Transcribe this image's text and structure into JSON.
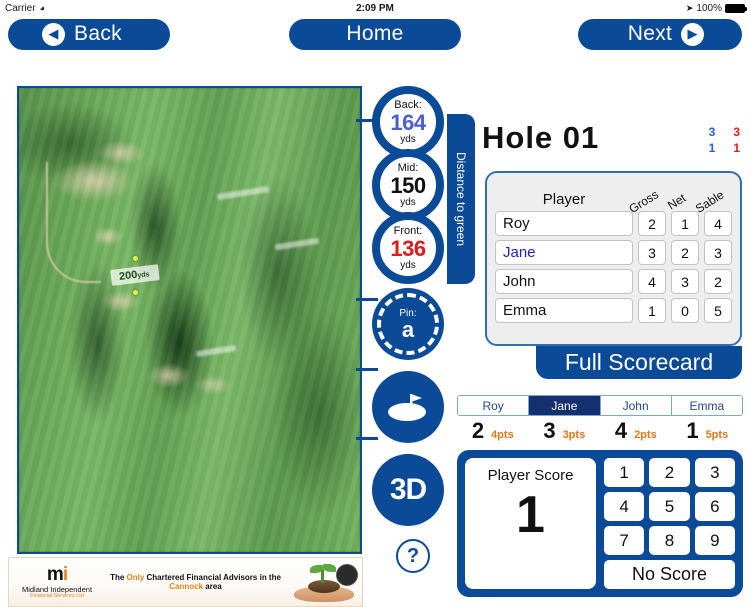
{
  "status_bar": {
    "carrier": "Carrier",
    "wifi_icon": "wifi-icon",
    "time": "2:09 PM",
    "location_icon": "location-arrow-icon",
    "battery_percent": "100%",
    "battery_icon": "battery-full-icon"
  },
  "nav": {
    "back_label": "Back",
    "back_icon": "chevron-left-circle-icon",
    "home_label": "Home",
    "next_label": "Next",
    "next_icon": "chevron-right-circle-icon"
  },
  "course": {
    "yardage_marker": "200",
    "yardage_unit": "yds"
  },
  "distances": {
    "tab_label": "Distance to green",
    "back": {
      "label": "Back:",
      "value": "164",
      "unit": "yds",
      "color": "#4a5fd0"
    },
    "mid": {
      "label": "Mid:",
      "value": "150",
      "unit": "yds",
      "color": "#111111"
    },
    "front": {
      "label": "Front:",
      "value": "136",
      "unit": "yds",
      "color": "#e01b1b"
    },
    "pin": {
      "label": "Pin:",
      "value": "a"
    }
  },
  "tools": {
    "green_view_icon": "green-flag-icon",
    "three_d_label": "3D",
    "help_label": "?"
  },
  "hole": {
    "title": "Hole 01",
    "par_blue_top": "3",
    "par_blue_bottom": "1",
    "par_red_top": "3",
    "par_red_bottom": "1"
  },
  "scorecard": {
    "headers": {
      "player": "Player",
      "gross": "Gross",
      "net": "Net",
      "stable": "Sable"
    },
    "rows": [
      {
        "name": "Roy",
        "gross": "2",
        "net": "1",
        "stable": "4",
        "active": false
      },
      {
        "name": "Jane",
        "gross": "3",
        "net": "2",
        "stable": "3",
        "active": true
      },
      {
        "name": "John",
        "gross": "4",
        "net": "3",
        "stable": "2",
        "active": false
      },
      {
        "name": "Emma",
        "gross": "1",
        "net": "0",
        "stable": "5",
        "active": false
      }
    ],
    "full_scorecard_label": "Full Scorecard"
  },
  "player_tabs": [
    {
      "label": "Roy",
      "selected": false
    },
    {
      "label": "Jane",
      "selected": true
    },
    {
      "label": "John",
      "selected": false
    },
    {
      "label": "Emma",
      "selected": false
    }
  ],
  "points_row": [
    {
      "score": "2",
      "points": "4pts"
    },
    {
      "score": "3",
      "points": "3pts"
    },
    {
      "score": "4",
      "points": "2pts"
    },
    {
      "score": "1",
      "points": "5pts"
    }
  ],
  "keypad": {
    "player_score_label": "Player Score",
    "player_score_value": "1",
    "keys": [
      "1",
      "2",
      "3",
      "4",
      "5",
      "6",
      "7",
      "8",
      "9"
    ],
    "no_score_label": "No Score"
  },
  "ad": {
    "logo_mark": "mi",
    "company": "Midland Independent",
    "company_sub": "Financial Services Ltd",
    "text_pre": "The ",
    "text_hi1": "Only",
    "text_mid": " Chartered Financial Advisors in the ",
    "text_hi2": "Cannock",
    "text_post": " area"
  },
  "colors": {
    "brand_blue": "#0a4a96",
    "tab_selected": "#14306e",
    "accent_orange": "#e07818",
    "red": "#e01b1b",
    "blue_value": "#4a5fd0"
  }
}
